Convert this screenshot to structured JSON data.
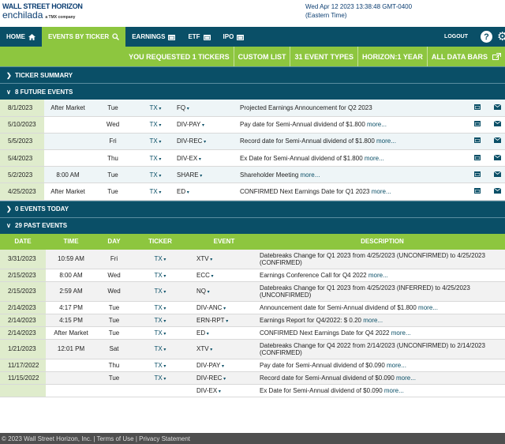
{
  "logo": {
    "line1": "WALL STREET HORIZON",
    "line2": "enchilada",
    "tmx": "a TMX company"
  },
  "datetime": {
    "line1": "Wed Apr 12 2023 13:38:48 GMT-0400",
    "line2": "(Eastern Time)"
  },
  "nav": {
    "home": "HOME",
    "events_by_ticker": "EVENTS BY TICKER",
    "earnings": "EARNINGS",
    "etf": "ETF",
    "ipo": "IPO",
    "logout": "LOGOUT",
    "help": "?"
  },
  "subbar": [
    "YOU REQUESTED 1 TICKERS",
    "CUSTOM LIST",
    "31 EVENT TYPES",
    "HORIZON:1 YEAR",
    "ALL DATA BARS"
  ],
  "sections": {
    "ticker_summary": "TICKER SUMMARY",
    "future": "8 FUTURE EVENTS",
    "today": "0 EVENTS TODAY",
    "past": "29 PAST EVENTS"
  },
  "future_events": [
    {
      "date": "8/1/2023",
      "time": "After Market",
      "day": "Tue",
      "ticker": "TX",
      "event": "FQ",
      "desc": "Projected Earnings Announcement for Q2 2023",
      "more": ""
    },
    {
      "date": "5/10/2023",
      "time": "",
      "day": "Wed",
      "ticker": "TX",
      "event": "DIV-PAY",
      "desc": "Pay date for Semi-Annual dividend of $1.800",
      "more": "more..."
    },
    {
      "date": "5/5/2023",
      "time": "",
      "day": "Fri",
      "ticker": "TX",
      "event": "DIV-REC",
      "desc": "Record date for Semi-Annual dividend of $1.800",
      "more": "more..."
    },
    {
      "date": "5/4/2023",
      "time": "",
      "day": "Thu",
      "ticker": "TX",
      "event": "DIV-EX",
      "desc": "Ex Date for Semi-Annual dividend of $1.800",
      "more": "more..."
    },
    {
      "date": "5/2/2023",
      "time": "8:00 AM",
      "day": "Tue",
      "ticker": "TX",
      "event": "SHARE",
      "desc": "Shareholder Meeting",
      "more": "more..."
    },
    {
      "date": "4/25/2023",
      "time": "After Market",
      "day": "Tue",
      "ticker": "TX",
      "event": "ED",
      "desc": "CONFIRMED Next Earnings Date for Q1 2023",
      "more": "more..."
    }
  ],
  "past_headers": [
    "DATE",
    "TIME",
    "DAY",
    "TICKER",
    "EVENT",
    "DESCRIPTION"
  ],
  "past_events": [
    {
      "date": "3/31/2023",
      "time": "10:59 AM",
      "day": "Fri",
      "ticker": "TX",
      "event": "XTV",
      "desc": "Datebreaks Change for Q1 2023 from 4/25/2023 (UNCONFIRMED) to 4/25/2023 (CONFIRMED)",
      "more": ""
    },
    {
      "date": "2/15/2023",
      "time": "8:00 AM",
      "day": "Wed",
      "ticker": "TX",
      "event": "ECC",
      "desc": "Earnings Conference Call for Q4 2022",
      "more": "more..."
    },
    {
      "date": "2/15/2023",
      "time": "2:59 AM",
      "day": "Wed",
      "ticker": "TX",
      "event": "NQ",
      "desc": "Datebreaks Change for Q1 2023 from 4/25/2023 (INFERRED) to 4/25/2023 (UNCONFIRMED)",
      "more": ""
    },
    {
      "date": "2/14/2023",
      "time": "4:17 PM",
      "day": "Tue",
      "ticker": "TX",
      "event": "DIV-ANC",
      "desc": "Announcement date for Semi-Annual dividend of $1.800",
      "more": "more..."
    },
    {
      "date": "2/14/2023",
      "time": "4:15 PM",
      "day": "Tue",
      "ticker": "TX",
      "event": "ERN-RPT",
      "desc": "Earnings Report for Q4/2022: $ 0.20",
      "more": "more..."
    },
    {
      "date": "2/14/2023",
      "time": "After Market",
      "day": "Tue",
      "ticker": "TX",
      "event": "ED",
      "desc": "CONFIRMED Next Earnings Date for Q4 2022",
      "more": "more..."
    },
    {
      "date": "1/21/2023",
      "time": "12:01 PM",
      "day": "Sat",
      "ticker": "TX",
      "event": "XTV",
      "desc": "Datebreaks Change for Q4 2022 from 2/14/2023 (UNCONFIRMED) to 2/14/2023 (CONFIRMED)",
      "more": ""
    },
    {
      "date": "11/17/2022",
      "time": "",
      "day": "Thu",
      "ticker": "TX",
      "event": "DIV-PAY",
      "desc": "Pay date for Semi-Annual dividend of $0.090",
      "more": "more..."
    },
    {
      "date": "11/15/2022",
      "time": "",
      "day": "Tue",
      "ticker": "TX",
      "event": "DIV-REC",
      "desc": "Record date for Semi-Annual dividend of $0.090",
      "more": "more..."
    },
    {
      "date": "",
      "time": "",
      "day": "",
      "ticker": "",
      "event": "DIV-EX",
      "desc": "Ex Date for Semi-Annual dividend of $0.090",
      "more": "more..."
    }
  ],
  "footer": "© 2023 Wall Street Horizon, Inc. | Terms of Use | Privacy Statement",
  "colors": {
    "navy": "#0a4f67",
    "green": "#8dc63f",
    "date_cell": "#dfeccc"
  }
}
